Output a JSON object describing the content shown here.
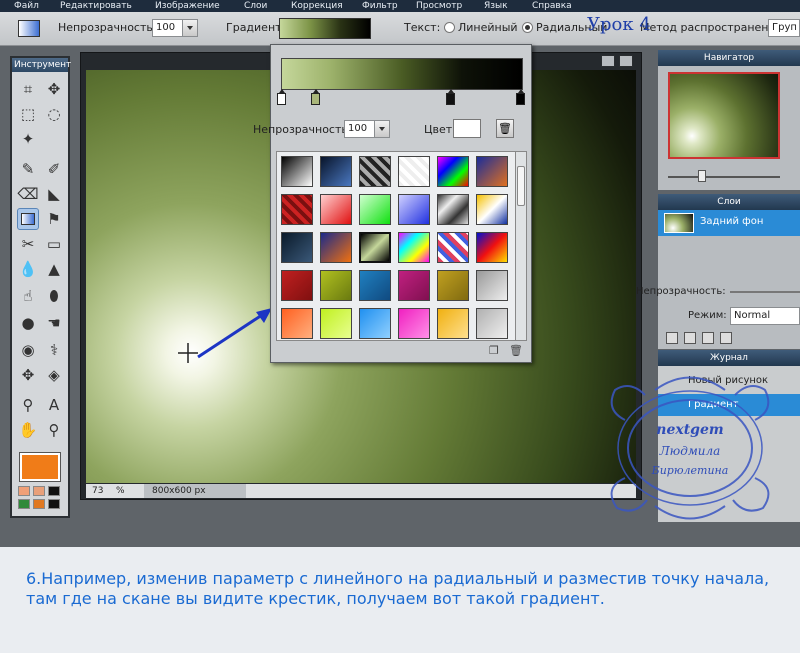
{
  "menu": [
    "Файл",
    "Редактировать",
    "Изображение",
    "Слои",
    "Коррекция",
    "Фильтр",
    "Просмотр",
    "Язык",
    "Справка"
  ],
  "options": {
    "opacity_label": "Непрозрачность:",
    "opacity_value": "100",
    "gradient_label": "Градиент:",
    "text_label": "Текст:",
    "linear_label": "Линейный",
    "radial_label": "Радиальный",
    "spread_label": "Метод распространения:",
    "spread_value": "Груп",
    "lesson_label": "Урок 4",
    "selected_type": "radial"
  },
  "tools": {
    "title": "Инструмент",
    "fg_color": "#f07c18"
  },
  "canvas": {
    "zoom": "73",
    "zoom_unit": "%",
    "size": "800x600 px"
  },
  "gradient_editor": {
    "opacity_label": "Непрозрачность:",
    "opacity_value": "100",
    "color_label": "Цвет:"
  },
  "navigator": {
    "title": "Навигатор"
  },
  "layers": {
    "title": "Слои",
    "layer_name": "Задний фон",
    "opacity_label": "Непрозрачность:",
    "mode_label": "Режим:",
    "mode_value": "Normal"
  },
  "history": {
    "title": "Журнал",
    "items": [
      "Новый рисунок",
      "Градиент"
    ]
  },
  "watermark": {
    "line1": "nextgem",
    "line2": "Людмила",
    "line3": "Бирюлетина"
  },
  "caption": "6.Например,  изменив параметр с линейного на радиальный и разместив точку начала, там где на скане вы видите крестик, получаем вот такой градиент."
}
